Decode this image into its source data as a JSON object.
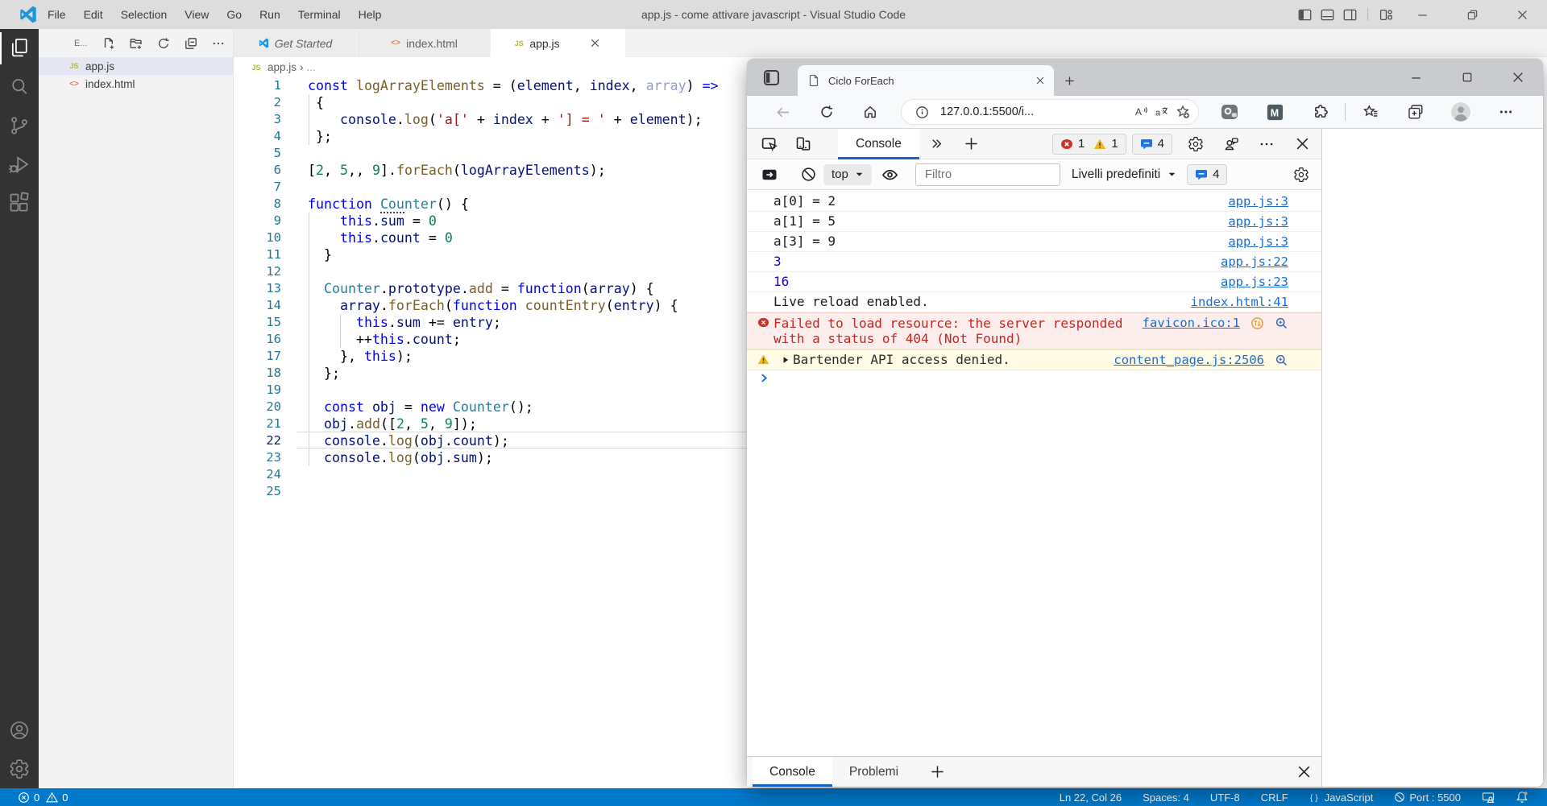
{
  "vscode": {
    "titlebar": {
      "title": "app.js - come attivare javascript - Visual Studio Code",
      "menus": [
        "File",
        "Edit",
        "Selection",
        "View",
        "Go",
        "Run",
        "Terminal",
        "Help"
      ]
    },
    "activitybar": {
      "top": [
        {
          "icon": "explorer-icon",
          "name": "explorer",
          "active": true
        },
        {
          "icon": "search-icon",
          "name": "search"
        },
        {
          "icon": "source-control-icon",
          "name": "source-control"
        },
        {
          "icon": "run-debug-icon",
          "name": "run-and-debug"
        },
        {
          "icon": "extensions-icon",
          "name": "extensions"
        }
      ],
      "bottom": [
        {
          "icon": "account-icon",
          "name": "account"
        },
        {
          "icon": "settings-gear-icon",
          "name": "settings"
        }
      ]
    },
    "sidebar": {
      "header_title": "E...",
      "actions": [
        {
          "icon": "new-file-icon",
          "name": "new-file"
        },
        {
          "icon": "new-folder-icon",
          "name": "new-folder"
        },
        {
          "icon": "refresh-icon",
          "name": "refresh-explorer"
        },
        {
          "icon": "collapse-all-icon",
          "name": "collapse-folders"
        },
        {
          "icon": "ellipsis-icon",
          "name": "more-actions"
        }
      ],
      "files": [
        {
          "icon": "js",
          "label": "app.js",
          "selected": true
        },
        {
          "icon": "html",
          "label": "index.html",
          "selected": false
        }
      ]
    },
    "tabs": [
      {
        "icon": "vscode",
        "label": "Get Started",
        "active": false,
        "italic": true,
        "close": false
      },
      {
        "icon": "html",
        "label": "index.html",
        "active": false,
        "italic": false,
        "close": false
      },
      {
        "icon": "js",
        "label": "app.js",
        "active": true,
        "italic": false,
        "close": true
      }
    ],
    "breadcrumb": {
      "icon": "js",
      "file": "app.js",
      "more": "..."
    },
    "editor": {
      "current_line": 22,
      "total_lines": 25,
      "indent_guides": [
        {
          "col": 0,
          "from": 2,
          "to": 4
        },
        {
          "col": 0,
          "from": 9,
          "to": 23
        },
        {
          "col": 4,
          "from": 15,
          "to": 16
        }
      ],
      "lines": [
        {
          "n": 1,
          "tokens": [
            [
              "k",
              "const"
            ],
            [
              "d",
              " "
            ],
            [
              "f",
              "logArrayElements"
            ],
            [
              "d",
              " = ("
            ],
            [
              "v",
              "element"
            ],
            [
              "d",
              ", "
            ],
            [
              "v",
              "index"
            ],
            [
              "d",
              ", "
            ],
            [
              "u",
              "array"
            ],
            [
              "d",
              ") "
            ],
            [
              "k",
              "=>"
            ]
          ]
        },
        {
          "n": 2,
          "tokens": [
            [
              "d",
              " {"
            ]
          ]
        },
        {
          "n": 3,
          "tokens": [
            [
              "d",
              "    "
            ],
            [
              "v",
              "console"
            ],
            [
              "d",
              "."
            ],
            [
              "f",
              "log"
            ],
            [
              "d",
              "("
            ],
            [
              "s",
              "'a['"
            ],
            [
              "d",
              " + "
            ],
            [
              "v",
              "index"
            ],
            [
              "d",
              " + "
            ],
            [
              "s",
              "'] = '"
            ],
            [
              "d",
              " + "
            ],
            [
              "v",
              "element"
            ],
            [
              "d",
              ");"
            ]
          ]
        },
        {
          "n": 4,
          "tokens": [
            [
              "d",
              " };"
            ]
          ]
        },
        {
          "n": 5,
          "tokens": []
        },
        {
          "n": 6,
          "tokens": [
            [
              "d",
              "["
            ],
            [
              "n",
              "2"
            ],
            [
              "d",
              ", "
            ],
            [
              "n",
              "5"
            ],
            [
              "d",
              ",, "
            ],
            [
              "n",
              "9"
            ],
            [
              "d",
              "]."
            ],
            [
              "f",
              "forEach"
            ],
            [
              "d",
              "("
            ],
            [
              "v",
              "logArrayElements"
            ],
            [
              "d",
              ");"
            ]
          ]
        },
        {
          "n": 7,
          "tokens": []
        },
        {
          "n": 8,
          "tokens": [
            [
              "k",
              "function"
            ],
            [
              "d",
              " "
            ],
            [
              "c dots",
              "Cou"
            ],
            [
              "c",
              "nter"
            ],
            [
              "d",
              "() {"
            ]
          ]
        },
        {
          "n": 9,
          "tokens": [
            [
              "d",
              "    "
            ],
            [
              "k",
              "this"
            ],
            [
              "d",
              "."
            ],
            [
              "v",
              "sum"
            ],
            [
              "d",
              " = "
            ],
            [
              "n",
              "0"
            ]
          ]
        },
        {
          "n": 10,
          "tokens": [
            [
              "d",
              "    "
            ],
            [
              "k",
              "this"
            ],
            [
              "d",
              "."
            ],
            [
              "v",
              "count"
            ],
            [
              "d",
              " = "
            ],
            [
              "n",
              "0"
            ]
          ]
        },
        {
          "n": 11,
          "tokens": [
            [
              "d",
              "  }"
            ]
          ]
        },
        {
          "n": 12,
          "tokens": []
        },
        {
          "n": 13,
          "tokens": [
            [
              "d",
              "  "
            ],
            [
              "c",
              "Counter"
            ],
            [
              "d",
              "."
            ],
            [
              "v",
              "prototype"
            ],
            [
              "d",
              "."
            ],
            [
              "f",
              "add"
            ],
            [
              "d",
              " = "
            ],
            [
              "k",
              "function"
            ],
            [
              "d",
              "("
            ],
            [
              "v",
              "array"
            ],
            [
              "d",
              ") {"
            ]
          ]
        },
        {
          "n": 14,
          "tokens": [
            [
              "d",
              "    "
            ],
            [
              "v",
              "array"
            ],
            [
              "d",
              "."
            ],
            [
              "f",
              "forEach"
            ],
            [
              "d",
              "("
            ],
            [
              "k",
              "function"
            ],
            [
              "d",
              " "
            ],
            [
              "f",
              "countEntry"
            ],
            [
              "d",
              "("
            ],
            [
              "v",
              "entry"
            ],
            [
              "d",
              ") {"
            ]
          ]
        },
        {
          "n": 15,
          "tokens": [
            [
              "d",
              "      "
            ],
            [
              "k",
              "this"
            ],
            [
              "d",
              "."
            ],
            [
              "v",
              "sum"
            ],
            [
              "d",
              " += "
            ],
            [
              "v",
              "entry"
            ],
            [
              "d",
              ";"
            ]
          ]
        },
        {
          "n": 16,
          "tokens": [
            [
              "d",
              "      ++"
            ],
            [
              "k",
              "this"
            ],
            [
              "d",
              "."
            ],
            [
              "v",
              "count"
            ],
            [
              "d",
              ";"
            ]
          ]
        },
        {
          "n": 17,
          "tokens": [
            [
              "d",
              "    }, "
            ],
            [
              "k",
              "this"
            ],
            [
              "d",
              ");"
            ]
          ]
        },
        {
          "n": 18,
          "tokens": [
            [
              "d",
              "  };"
            ]
          ]
        },
        {
          "n": 19,
          "tokens": []
        },
        {
          "n": 20,
          "tokens": [
            [
              "d",
              "  "
            ],
            [
              "k",
              "const"
            ],
            [
              "d",
              " "
            ],
            [
              "v",
              "obj"
            ],
            [
              "d",
              " = "
            ],
            [
              "k",
              "new"
            ],
            [
              "d",
              " "
            ],
            [
              "c",
              "Counter"
            ],
            [
              "d",
              "();"
            ]
          ]
        },
        {
          "n": 21,
          "tokens": [
            [
              "d",
              "  "
            ],
            [
              "v",
              "obj"
            ],
            [
              "d",
              "."
            ],
            [
              "f",
              "add"
            ],
            [
              "d",
              "(["
            ],
            [
              "n",
              "2"
            ],
            [
              "d",
              ", "
            ],
            [
              "n",
              "5"
            ],
            [
              "d",
              ", "
            ],
            [
              "n",
              "9"
            ],
            [
              "d",
              "]);"
            ]
          ]
        },
        {
          "n": 22,
          "tokens": [
            [
              "d",
              "  "
            ],
            [
              "v",
              "console"
            ],
            [
              "d",
              "."
            ],
            [
              "f",
              "log"
            ],
            [
              "d",
              "("
            ],
            [
              "v",
              "obj"
            ],
            [
              "d",
              "."
            ],
            [
              "v",
              "count"
            ],
            [
              "d",
              ");"
            ]
          ]
        },
        {
          "n": 23,
          "tokens": [
            [
              "d",
              "  "
            ],
            [
              "v",
              "console"
            ],
            [
              "d",
              "."
            ],
            [
              "f",
              "log"
            ],
            [
              "d",
              "("
            ],
            [
              "v",
              "obj"
            ],
            [
              "d",
              "."
            ],
            [
              "v",
              "sum"
            ],
            [
              "d",
              ");"
            ]
          ]
        },
        {
          "n": 24,
          "tokens": []
        },
        {
          "n": 25,
          "tokens": []
        }
      ]
    },
    "statusbar": {
      "left": [
        {
          "icon": "error-circle-icon",
          "text": "0",
          "name": "errors-count"
        },
        {
          "icon": "warning-triangle-icon",
          "text": "0",
          "name": "warnings-count"
        }
      ],
      "right": [
        {
          "text": "Ln 22, Col 26",
          "name": "cursor-position"
        },
        {
          "text": "Spaces: 4",
          "name": "indentation"
        },
        {
          "text": "UTF-8",
          "name": "encoding"
        },
        {
          "text": "CRLF",
          "name": "eol-sequence"
        },
        {
          "icon": "braces-icon",
          "text": "JavaScript",
          "name": "language-mode"
        },
        {
          "icon": "blocked-icon",
          "text": "Port : 5500",
          "name": "live-server-port"
        },
        {
          "icon": "screencast-icon",
          "text": "",
          "name": "feedback"
        },
        {
          "icon": "bell-icon",
          "text": "",
          "name": "notifications"
        }
      ]
    }
  },
  "browser": {
    "tab_title": "Ciclo ForEach",
    "url": "127.0.0.1:5500/i...",
    "devtools": {
      "active_tab": "Console",
      "badges": {
        "errors": "1",
        "warnings": "1",
        "messages": "4"
      },
      "toolbar": {
        "context": "top",
        "filter_placeholder": "Filtro",
        "levels_label": "Livelli predefiniti",
        "messages_count": "4"
      },
      "console_rows": [
        {
          "type": "log",
          "text": "a[0] = 2",
          "link": "app.js:3"
        },
        {
          "type": "log",
          "text": "a[1] = 5",
          "link": "app.js:3"
        },
        {
          "type": "log",
          "text": "a[3] = 9",
          "link": "app.js:3"
        },
        {
          "type": "result",
          "text": "3",
          "link": "app.js:22"
        },
        {
          "type": "result",
          "text": "16",
          "link": "app.js:23"
        },
        {
          "type": "log",
          "text": "Live reload enabled.",
          "link": "index.html:41"
        },
        {
          "type": "error",
          "text": "Failed to load resource: the server responded with a status of 404 (Not Found)",
          "link": "favicon.ico:1",
          "icons": [
            "issue-counter-icon",
            "search-issues-icon"
          ]
        },
        {
          "type": "warning",
          "text": "Bartender API access denied.",
          "link": "content_page.js:2506",
          "icons": [
            "search-issues-icon"
          ],
          "expandable": true
        },
        {
          "type": "prompt"
        }
      ],
      "drawer_tabs": [
        {
          "label": "Console",
          "active": true
        },
        {
          "label": "Problemi",
          "active": false
        }
      ]
    }
  }
}
